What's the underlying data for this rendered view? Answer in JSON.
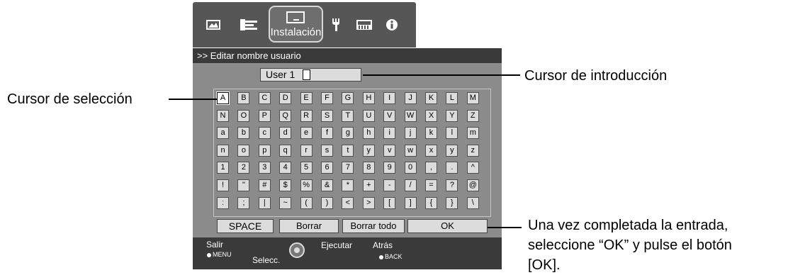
{
  "top_bar": {
    "active_tab": "Instalación",
    "icons": [
      "picture-adjust-icon",
      "input-signal-icon",
      "installation-icon",
      "display-setup-icon",
      "function-icon",
      "information-icon"
    ]
  },
  "dialog": {
    "title": ">> Editar nombre usuario",
    "input_value": "User 1",
    "keyboard_rows": [
      [
        "A",
        "B",
        "C",
        "D",
        "E",
        "F",
        "G",
        "H",
        "I",
        "J",
        "K",
        "L",
        "M"
      ],
      [
        "N",
        "O",
        "P",
        "Q",
        "R",
        "S",
        "T",
        "U",
        "V",
        "W",
        "X",
        "Y",
        "Z"
      ],
      [
        "a",
        "b",
        "c",
        "d",
        "e",
        "f",
        "g",
        "h",
        "i",
        "j",
        "k",
        "l",
        "m"
      ],
      [
        "n",
        "o",
        "p",
        "q",
        "r",
        "s",
        "t",
        "y",
        "v",
        "w",
        "x",
        "y",
        "z"
      ],
      [
        "1",
        "2",
        "3",
        "4",
        "5",
        "6",
        "7",
        "8",
        "9",
        "0",
        ",",
        ".",
        "^"
      ],
      [
        "!",
        "\"",
        "#",
        "$",
        "%",
        "&",
        "*",
        "+",
        "-",
        "/",
        "=",
        "?",
        "@"
      ],
      [
        ":",
        ";",
        "|",
        "~",
        "(",
        ")",
        "<",
        ">",
        "[",
        "]",
        "{",
        "}",
        "\\"
      ]
    ],
    "buttons": {
      "space": "SPACE",
      "delete": "Borrar",
      "delete_all": "Borrar todo",
      "ok": "OK"
    }
  },
  "footer": {
    "exit_label": "Salir",
    "exit_key": "MENU",
    "select_label": "Selecc.",
    "execute_label": "Ejecutar",
    "back_label": "Atrás",
    "back_key": "BACK"
  },
  "callouts": {
    "input_cursor": "Cursor de introducción",
    "selection_cursor": "Cursor de selección",
    "ok_line1": "Una vez completada la entrada,",
    "ok_line2": "seleccione “OK” y pulse el botón",
    "ok_line3": "[OK]."
  }
}
